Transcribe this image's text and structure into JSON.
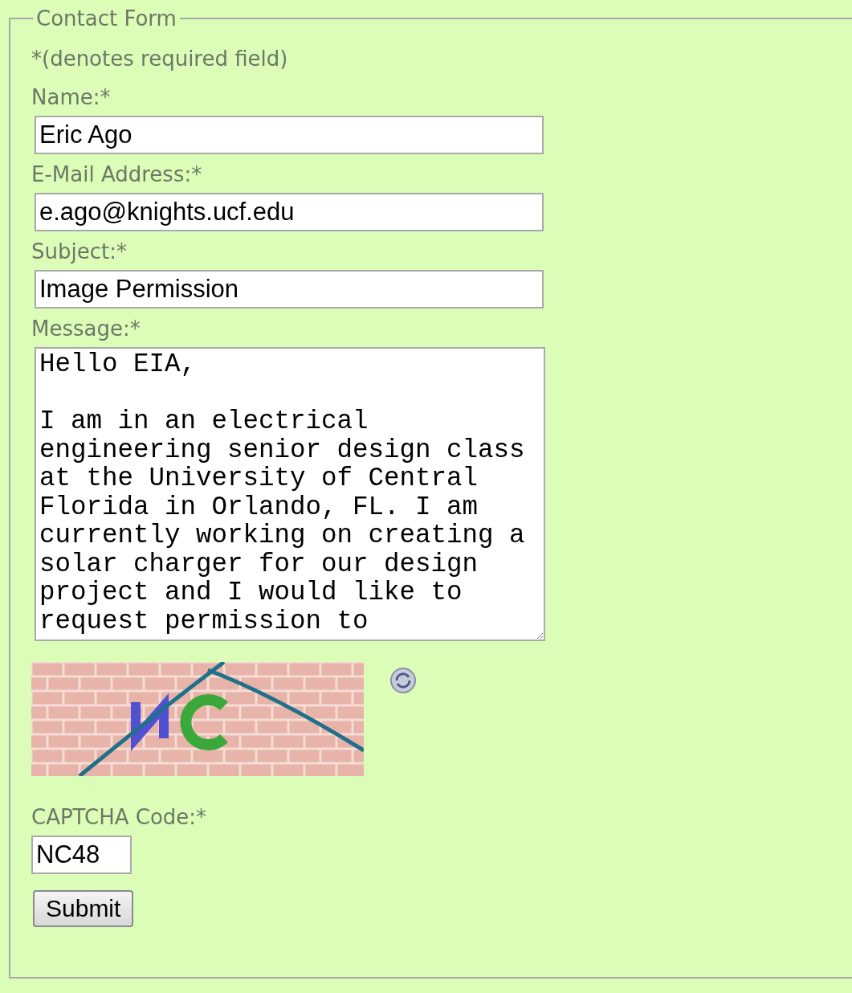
{
  "form": {
    "legend": "Contact Form",
    "note": "*(denotes required field)",
    "fields": [
      {
        "kind": "text",
        "label": "Name:*",
        "value": "Eric Ago"
      },
      {
        "kind": "text",
        "label": "E-Mail Address:*",
        "value": "e.ago@knights.ucf.edu"
      },
      {
        "kind": "text",
        "label": "Subject:*",
        "value": "Image Permission"
      },
      {
        "kind": "textarea",
        "label": "Message:*",
        "value": "Hello EIA,\n\nI am in an electrical engineering senior design class at the University of Central Florida in Orlando, FL. I am currently working on creating a solar charger for our design project and I would like to request permission to"
      }
    ],
    "captcha": {
      "label": "CAPTCHA Code:*",
      "value": "NC48"
    },
    "submit": "Submit"
  }
}
